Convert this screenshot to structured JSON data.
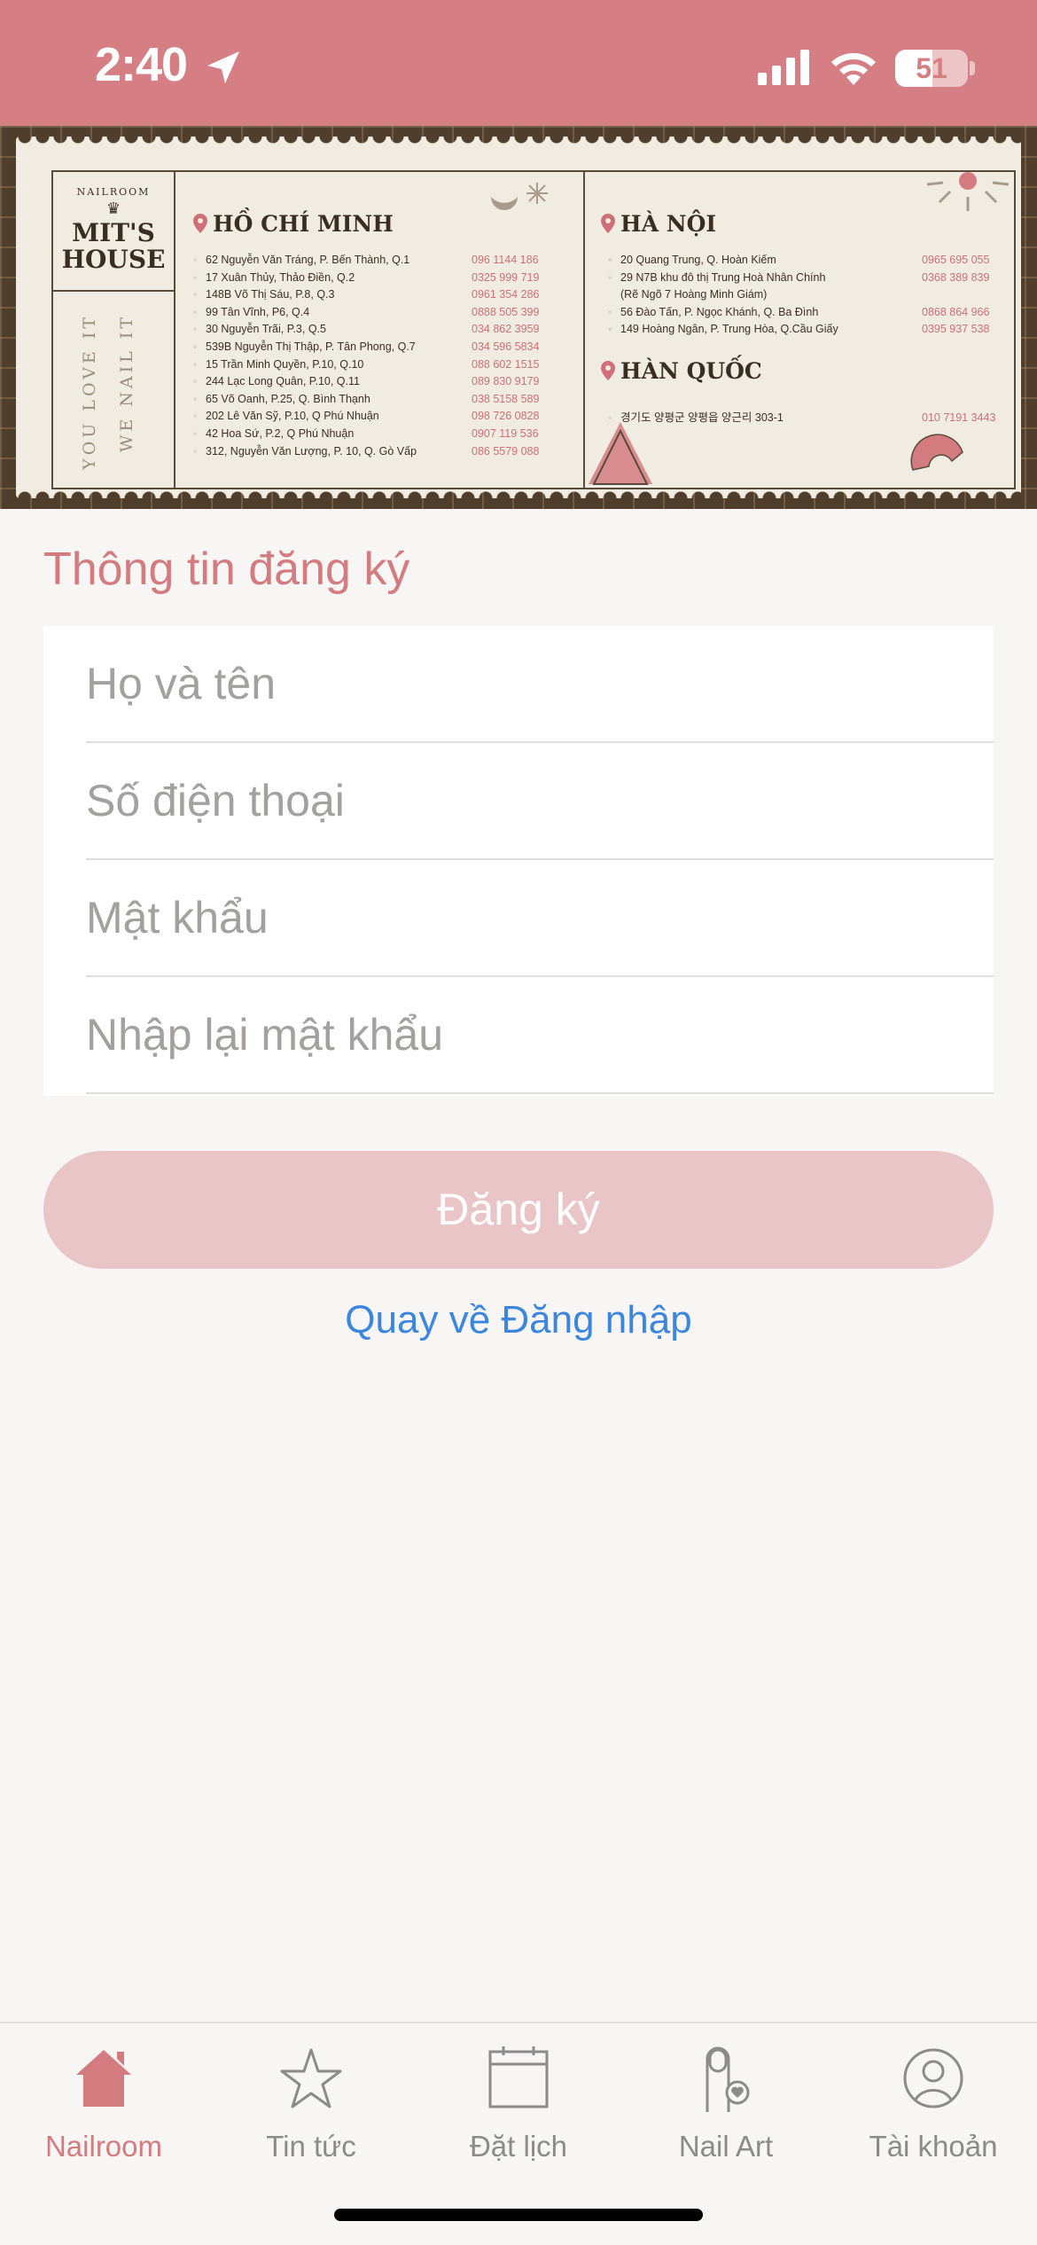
{
  "status_bar": {
    "time": "2:40",
    "battery": "51",
    "battery_level": 0.51
  },
  "banner": {
    "brand_small": "NAILROOM",
    "brand_mark": "♛",
    "brand_line1": "MIT'S",
    "brand_line2": "HOUSE",
    "tagline_1": "YOU LOVE IT",
    "tagline_2": "WE NAIL IT",
    "hcm": {
      "title": "HỒ CHÍ MINH",
      "items": [
        {
          "address": "62 Nguyễn Văn Tráng, P. Bến Thành, Q.1",
          "phone": "096 1144 186"
        },
        {
          "address": "17 Xuân Thủy, Thảo Điền, Q.2",
          "phone": "0325 999 719"
        },
        {
          "address": "148B Võ Thị Sáu, P.8, Q.3",
          "phone": "0961 354 286"
        },
        {
          "address": "99 Tân Vĩnh, P6, Q.4",
          "phone": "0888 505 399"
        },
        {
          "address": "30 Nguyễn Trãi, P.3, Q.5",
          "phone": "034 862 3959"
        },
        {
          "address": "539B Nguyễn Thị Thập, P. Tân Phong, Q.7",
          "phone": "034 596 5834"
        },
        {
          "address": "15 Trần Minh Quyền, P.10, Q.10",
          "phone": "088 602 1515"
        },
        {
          "address": "244 Lạc Long Quân, P.10, Q.11",
          "phone": "089 830 9179"
        },
        {
          "address": "65 Võ Oanh, P.25, Q. Bình Thạnh",
          "phone": "038 5158 589"
        },
        {
          "address": "202 Lê Văn Sỹ, P.10, Q Phú Nhuận",
          "phone": "098 726 0828"
        },
        {
          "address": "42 Hoa Sứ, P.2, Q Phú Nhuận",
          "phone": "0907 119 536"
        },
        {
          "address": "312, Nguyễn Văn Lượng, P. 10, Q. Gò Vấp",
          "phone": "086 5579 088"
        }
      ]
    },
    "hn": {
      "title": "HÀ NỘI",
      "items": [
        {
          "address": "20 Quang Trung, Q. Hoàn Kiếm",
          "phone": "0965 695 055"
        },
        {
          "address": "29 N7B khu đô thị Trung Hoà Nhân Chính",
          "phone": "0368 389 839"
        },
        {
          "address": "(Rẽ Ngõ 7 Hoàng Minh Giám)",
          "phone": ""
        },
        {
          "address": "56 Đào Tấn, P. Ngọc Khánh, Q. Ba Đình",
          "phone": "0868 864 966"
        },
        {
          "address": "149 Hoàng Ngân, P. Trung Hòa, Q.Cầu Giấy",
          "phone": "0395 937 538"
        }
      ]
    },
    "kr": {
      "title": "HÀN QUỐC",
      "items": [
        {
          "address": "경기도 양평군 양평읍 양근리 303-1",
          "phone": "010 7191 3443"
        }
      ]
    }
  },
  "form": {
    "title": "Thông tin đăng ký",
    "full_name_placeholder": "Họ và tên",
    "phone_placeholder": "Số điện thoại",
    "password_placeholder": "Mật khẩu",
    "confirm_password_placeholder": "Nhập lại mật khẩu",
    "register_label": "Đăng ký",
    "back_to_login_label": "Quay về Đăng nhập"
  },
  "tab_bar": {
    "tabs": [
      {
        "label": "Nailroom",
        "icon": "house-icon",
        "active": true
      },
      {
        "label": "Tin tức",
        "icon": "star-icon",
        "active": false
      },
      {
        "label": "Đặt lịch",
        "icon": "calendar-icon",
        "active": false
      },
      {
        "label": "Nail Art",
        "icon": "nail-heart-icon",
        "active": false
      },
      {
        "label": "Tài khoản",
        "icon": "user-icon",
        "active": false
      }
    ]
  },
  "colors": {
    "status_bar": "#d57f84",
    "accent": "#d47b80",
    "button_disabled": "#eac5c8",
    "link": "#3c86e0",
    "banner_dark": "#4f3e2c",
    "banner_paper": "#f1ece1",
    "tab_inactive": "#8b8b8b"
  }
}
